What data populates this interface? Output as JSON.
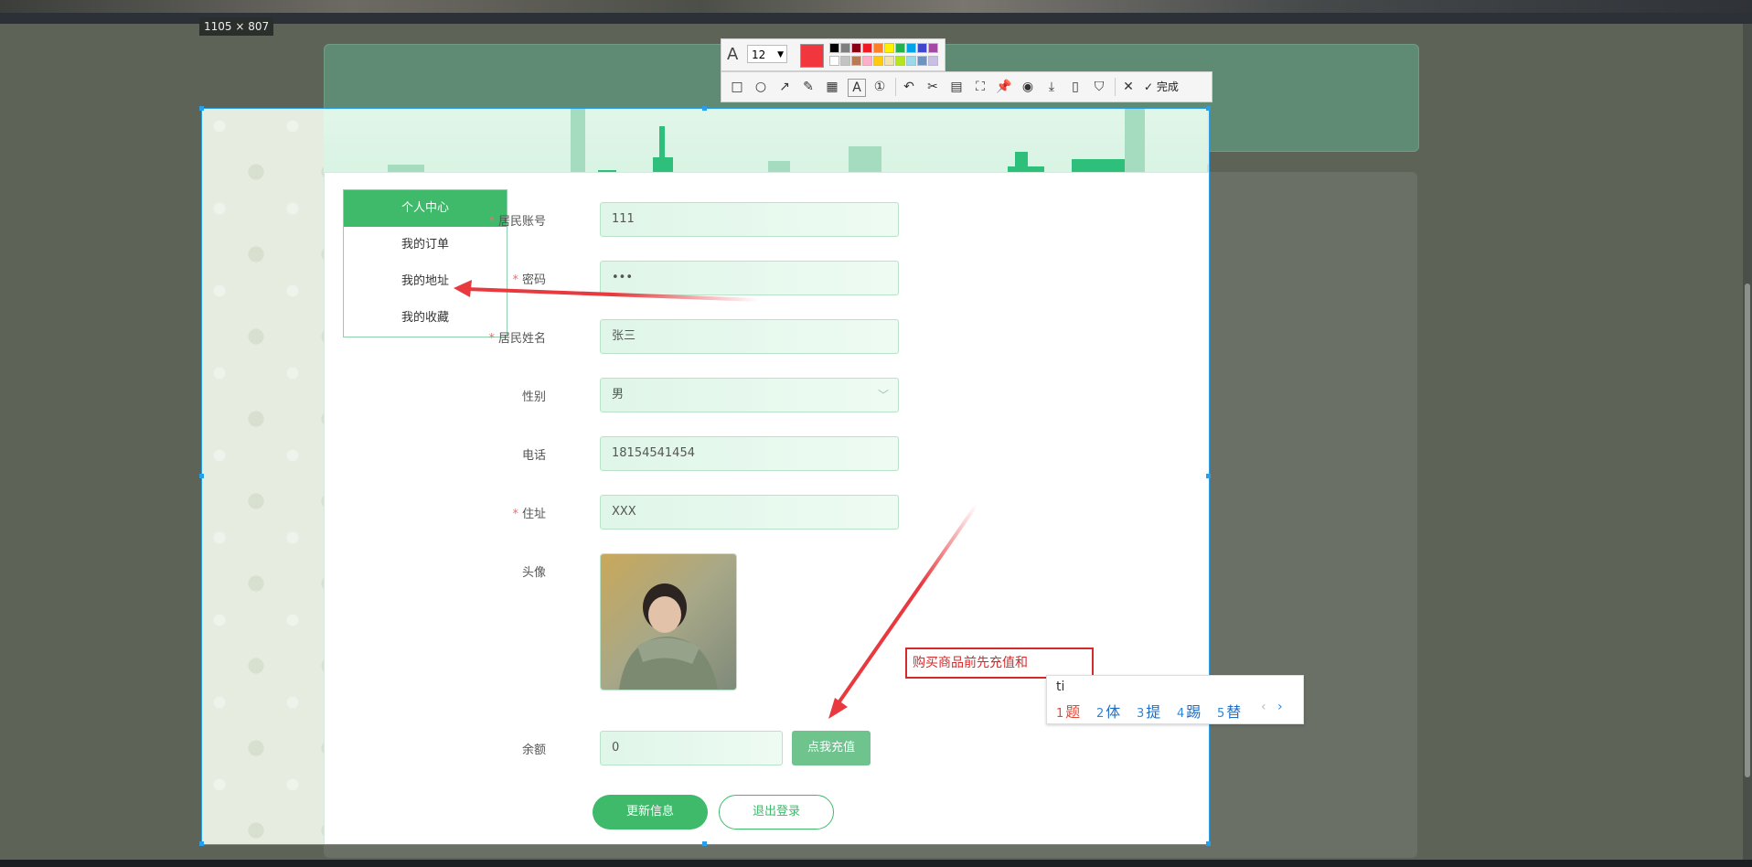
{
  "screenshot_tool": {
    "size_label": "1105 × 807",
    "font_size": "12",
    "done_label": "完成",
    "active_color": "#f2363e",
    "palette": [
      "#000000",
      "#7f7f7f",
      "#880015",
      "#ed1c24",
      "#ff7f27",
      "#fff200",
      "#22b14c",
      "#00a2e8",
      "#3f48cc",
      "#a349a4",
      "#ffffff",
      "#c3c3c3",
      "#b97a57",
      "#ffaec9",
      "#ffc90e",
      "#efe4b0",
      "#b5e61d",
      "#99d9ea",
      "#7092be",
      "#c8bfe7"
    ],
    "text_input": "购买商品前先充值和"
  },
  "ime": {
    "pinyin": "ti",
    "candidates": [
      {
        "num": "1",
        "char": "题"
      },
      {
        "num": "2",
        "char": "体"
      },
      {
        "num": "3",
        "char": "提"
      },
      {
        "num": "4",
        "char": "踢"
      },
      {
        "num": "5",
        "char": "替"
      }
    ],
    "prev": "‹",
    "next": "›"
  },
  "header": {
    "title": "个人中心"
  },
  "menu": {
    "items": [
      {
        "label": "个人中心",
        "active": true
      },
      {
        "label": "我的订单"
      },
      {
        "label": "我的地址"
      },
      {
        "label": "我的收藏"
      }
    ]
  },
  "form": {
    "account": {
      "label": "居民账号",
      "value": "111",
      "required": "*"
    },
    "password": {
      "label": "密码",
      "value": "•••",
      "required": "*"
    },
    "name": {
      "label": "居民姓名",
      "value": "张三",
      "required": "*"
    },
    "gender": {
      "label": "性别",
      "value": "男"
    },
    "phone": {
      "label": "电话",
      "value": "18154541454"
    },
    "address": {
      "label": "住址",
      "value": "XXX",
      "required": "*"
    },
    "avatar": {
      "label": "头像"
    },
    "balance": {
      "label": "余额",
      "value": "0",
      "recharge_label": "点我充值"
    },
    "update_label": "更新信息",
    "logout_label": "退出登录"
  },
  "colors": {
    "accent": "#3fba6b",
    "annotation_red": "#e8393f",
    "selection_blue": "#2a9fe6"
  }
}
